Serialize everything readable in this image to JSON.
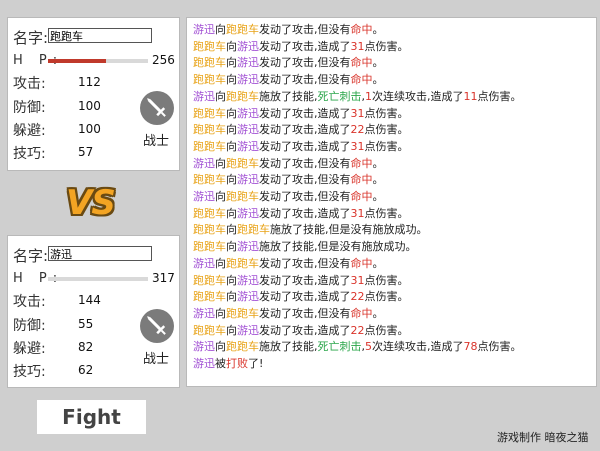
{
  "fighter1": {
    "name_label": "名字:",
    "name_value": "跑跑车",
    "hp_label": "H P:",
    "hp_value": "256",
    "hp_fraction": 0.58,
    "attack_label": "攻击:",
    "attack_value": "112",
    "defense_label": "防御:",
    "defense_value": "100",
    "dodge_label": "躲避:",
    "dodge_value": "100",
    "skill_label": "技巧:",
    "skill_value": "57",
    "class_label": "战士"
  },
  "fighter2": {
    "name_label": "名字:",
    "name_value": "游迅",
    "hp_label": "H P:",
    "hp_value": "317",
    "hp_fraction": 0.0,
    "attack_label": "攻击:",
    "attack_value": "144",
    "defense_label": "防御:",
    "defense_value": "55",
    "dodge_label": "躲避:",
    "dodge_value": "82",
    "skill_label": "技巧:",
    "skill_value": "62",
    "class_label": "战士"
  },
  "vs_text": "VS",
  "fight_button": "Fight",
  "credit": "游戏制作 暗夜之猫",
  "colors": {
    "name_a": "#a04dd3",
    "name_b": "#e8a317",
    "red": "#d9342b",
    "green": "#2aa64a"
  },
  "log": [
    [
      [
        "游迅",
        "a"
      ],
      [
        "向",
        ""
      ],
      [
        "跑跑车",
        "b"
      ],
      [
        "发动了攻击,但没有",
        ""
      ],
      [
        "命中",
        "r"
      ],
      [
        "。",
        ""
      ]
    ],
    [
      [
        "跑跑车",
        "b"
      ],
      [
        "向",
        ""
      ],
      [
        "游迅",
        "a"
      ],
      [
        "发动了攻击,造成了",
        ""
      ],
      [
        "31",
        "r"
      ],
      [
        "点伤害。",
        ""
      ]
    ],
    [
      [
        "跑跑车",
        "b"
      ],
      [
        "向",
        ""
      ],
      [
        "游迅",
        "a"
      ],
      [
        "发动了攻击,但没有",
        ""
      ],
      [
        "命中",
        "r"
      ],
      [
        "。",
        ""
      ]
    ],
    [
      [
        "跑跑车",
        "b"
      ],
      [
        "向",
        ""
      ],
      [
        "游迅",
        "a"
      ],
      [
        "发动了攻击,但没有",
        ""
      ],
      [
        "命中",
        "r"
      ],
      [
        "。",
        ""
      ]
    ],
    [
      [
        "游迅",
        "a"
      ],
      [
        "向",
        ""
      ],
      [
        "跑跑车",
        "b"
      ],
      [
        "施放了技能,",
        ""
      ],
      [
        "死亡刺击",
        "g"
      ],
      [
        ",",
        ""
      ],
      [
        "1",
        "r"
      ],
      [
        "次连续攻击,造成了",
        ""
      ],
      [
        "11",
        "r"
      ],
      [
        "点伤害。",
        ""
      ]
    ],
    [
      [
        "跑跑车",
        "b"
      ],
      [
        "向",
        ""
      ],
      [
        "游迅",
        "a"
      ],
      [
        "发动了攻击,造成了",
        ""
      ],
      [
        "31",
        "r"
      ],
      [
        "点伤害。",
        ""
      ]
    ],
    [
      [
        "跑跑车",
        "b"
      ],
      [
        "向",
        ""
      ],
      [
        "游迅",
        "a"
      ],
      [
        "发动了攻击,造成了",
        ""
      ],
      [
        "22",
        "r"
      ],
      [
        "点伤害。",
        ""
      ]
    ],
    [
      [
        "跑跑车",
        "b"
      ],
      [
        "向",
        ""
      ],
      [
        "游迅",
        "a"
      ],
      [
        "发动了攻击,造成了",
        ""
      ],
      [
        "31",
        "r"
      ],
      [
        "点伤害。",
        ""
      ]
    ],
    [
      [
        "游迅",
        "a"
      ],
      [
        "向",
        ""
      ],
      [
        "跑跑车",
        "b"
      ],
      [
        "发动了攻击,但没有",
        ""
      ],
      [
        "命中",
        "r"
      ],
      [
        "。",
        ""
      ]
    ],
    [
      [
        "跑跑车",
        "b"
      ],
      [
        "向",
        ""
      ],
      [
        "游迅",
        "a"
      ],
      [
        "发动了攻击,但没有",
        ""
      ],
      [
        "命中",
        "r"
      ],
      [
        "。",
        ""
      ]
    ],
    [
      [
        "游迅",
        "a"
      ],
      [
        "向",
        ""
      ],
      [
        "跑跑车",
        "b"
      ],
      [
        "发动了攻击,但没有",
        ""
      ],
      [
        "命中",
        "r"
      ],
      [
        "。",
        ""
      ]
    ],
    [
      [
        "跑跑车",
        "b"
      ],
      [
        "向",
        ""
      ],
      [
        "游迅",
        "a"
      ],
      [
        "发动了攻击,造成了",
        ""
      ],
      [
        "31",
        "r"
      ],
      [
        "点伤害。",
        ""
      ]
    ],
    [
      [
        "跑跑车",
        "b"
      ],
      [
        "向",
        ""
      ],
      [
        "跑跑车",
        "b"
      ],
      [
        "施放了技能,但是没有施放成功。",
        ""
      ]
    ],
    [
      [
        "跑跑车",
        "b"
      ],
      [
        "向",
        ""
      ],
      [
        "游迅",
        "a"
      ],
      [
        "施放了技能,但是没有施放成功。",
        ""
      ]
    ],
    [
      [
        "游迅",
        "a"
      ],
      [
        "向",
        ""
      ],
      [
        "跑跑车",
        "b"
      ],
      [
        "发动了攻击,但没有",
        ""
      ],
      [
        "命中",
        "r"
      ],
      [
        "。",
        ""
      ]
    ],
    [
      [
        "跑跑车",
        "b"
      ],
      [
        "向",
        ""
      ],
      [
        "游迅",
        "a"
      ],
      [
        "发动了攻击,造成了",
        ""
      ],
      [
        "31",
        "r"
      ],
      [
        "点伤害。",
        ""
      ]
    ],
    [
      [
        "跑跑车",
        "b"
      ],
      [
        "向",
        ""
      ],
      [
        "游迅",
        "a"
      ],
      [
        "发动了攻击,造成了",
        ""
      ],
      [
        "22",
        "r"
      ],
      [
        "点伤害。",
        ""
      ]
    ],
    [
      [
        "游迅",
        "a"
      ],
      [
        "向",
        ""
      ],
      [
        "跑跑车",
        "b"
      ],
      [
        "发动了攻击,但没有",
        ""
      ],
      [
        "命中",
        "r"
      ],
      [
        "。",
        ""
      ]
    ],
    [
      [
        "跑跑车",
        "b"
      ],
      [
        "向",
        ""
      ],
      [
        "游迅",
        "a"
      ],
      [
        "发动了攻击,造成了",
        ""
      ],
      [
        "22",
        "r"
      ],
      [
        "点伤害。",
        ""
      ]
    ],
    [
      [
        "游迅",
        "a"
      ],
      [
        "向",
        ""
      ],
      [
        "跑跑车",
        "b"
      ],
      [
        "施放了技能,",
        ""
      ],
      [
        "死亡刺击",
        "g"
      ],
      [
        ",",
        ""
      ],
      [
        "5",
        "r"
      ],
      [
        "次连续攻击,造成了",
        ""
      ],
      [
        "78",
        "r"
      ],
      [
        "点伤害。",
        ""
      ]
    ],
    [
      [
        "游迅",
        "a"
      ],
      [
        "被",
        ""
      ],
      [
        "打败",
        "r"
      ],
      [
        "了!",
        ""
      ]
    ]
  ]
}
